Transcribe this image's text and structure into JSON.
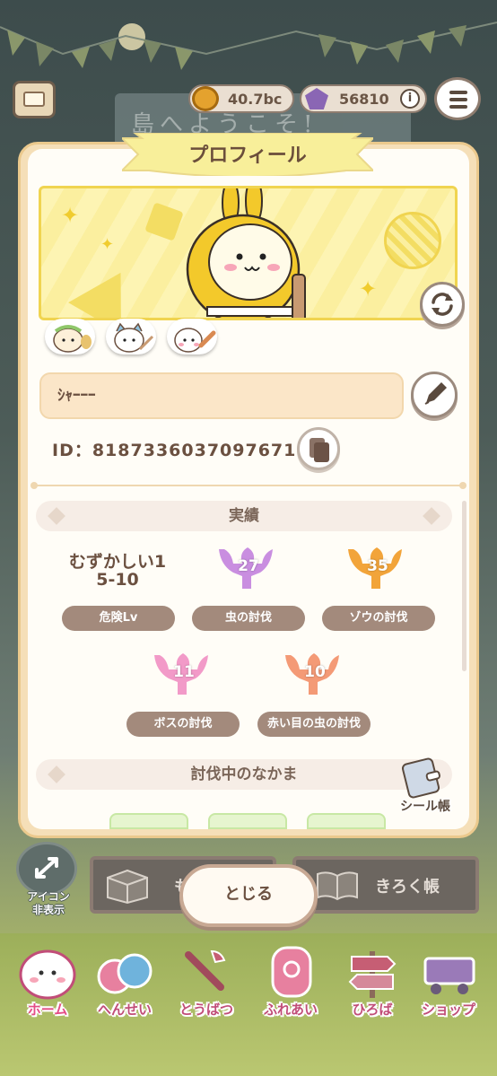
{
  "top_bar": {
    "coins": "40.7bc",
    "gems": "56810",
    "info_symbol": "i"
  },
  "background": {
    "sign_text": "島へようこそ!"
  },
  "dialog": {
    "title": "プロフィール",
    "player_name": "ｼｬｰｰｰ",
    "player_id": "ID：8187336037097671",
    "achievements_header": "実績",
    "achievements": [
      {
        "value": "むずかしい1\n5-10",
        "label": "危険Lv"
      },
      {
        "value": "27",
        "label": "虫の討伐",
        "color": "#c98ee0"
      },
      {
        "value": "35",
        "label": "ゾウの討伐",
        "color": "#f2a43a"
      },
      {
        "value": "11",
        "label": "ボスの討伐",
        "color": "#f29ac8"
      },
      {
        "value": "10",
        "label": "赤い目の虫の討伐",
        "color": "#f49a76"
      }
    ],
    "companions_header": "討伐中のなかま",
    "seal_book_label": "シール帳"
  },
  "bottom_buttons": {
    "icon_hide_label_1": "アイコン",
    "icon_hide_label_2": "非表示",
    "left_button_label": "も",
    "right_button_label": "きろく帳",
    "close_label": "とじる"
  },
  "nav": [
    {
      "label": "ホーム",
      "active": true
    },
    {
      "label": "へんせい"
    },
    {
      "label": "とうばつ"
    },
    {
      "label": "ふれあい"
    },
    {
      "label": "ひろば"
    },
    {
      "label": "ショップ"
    }
  ]
}
